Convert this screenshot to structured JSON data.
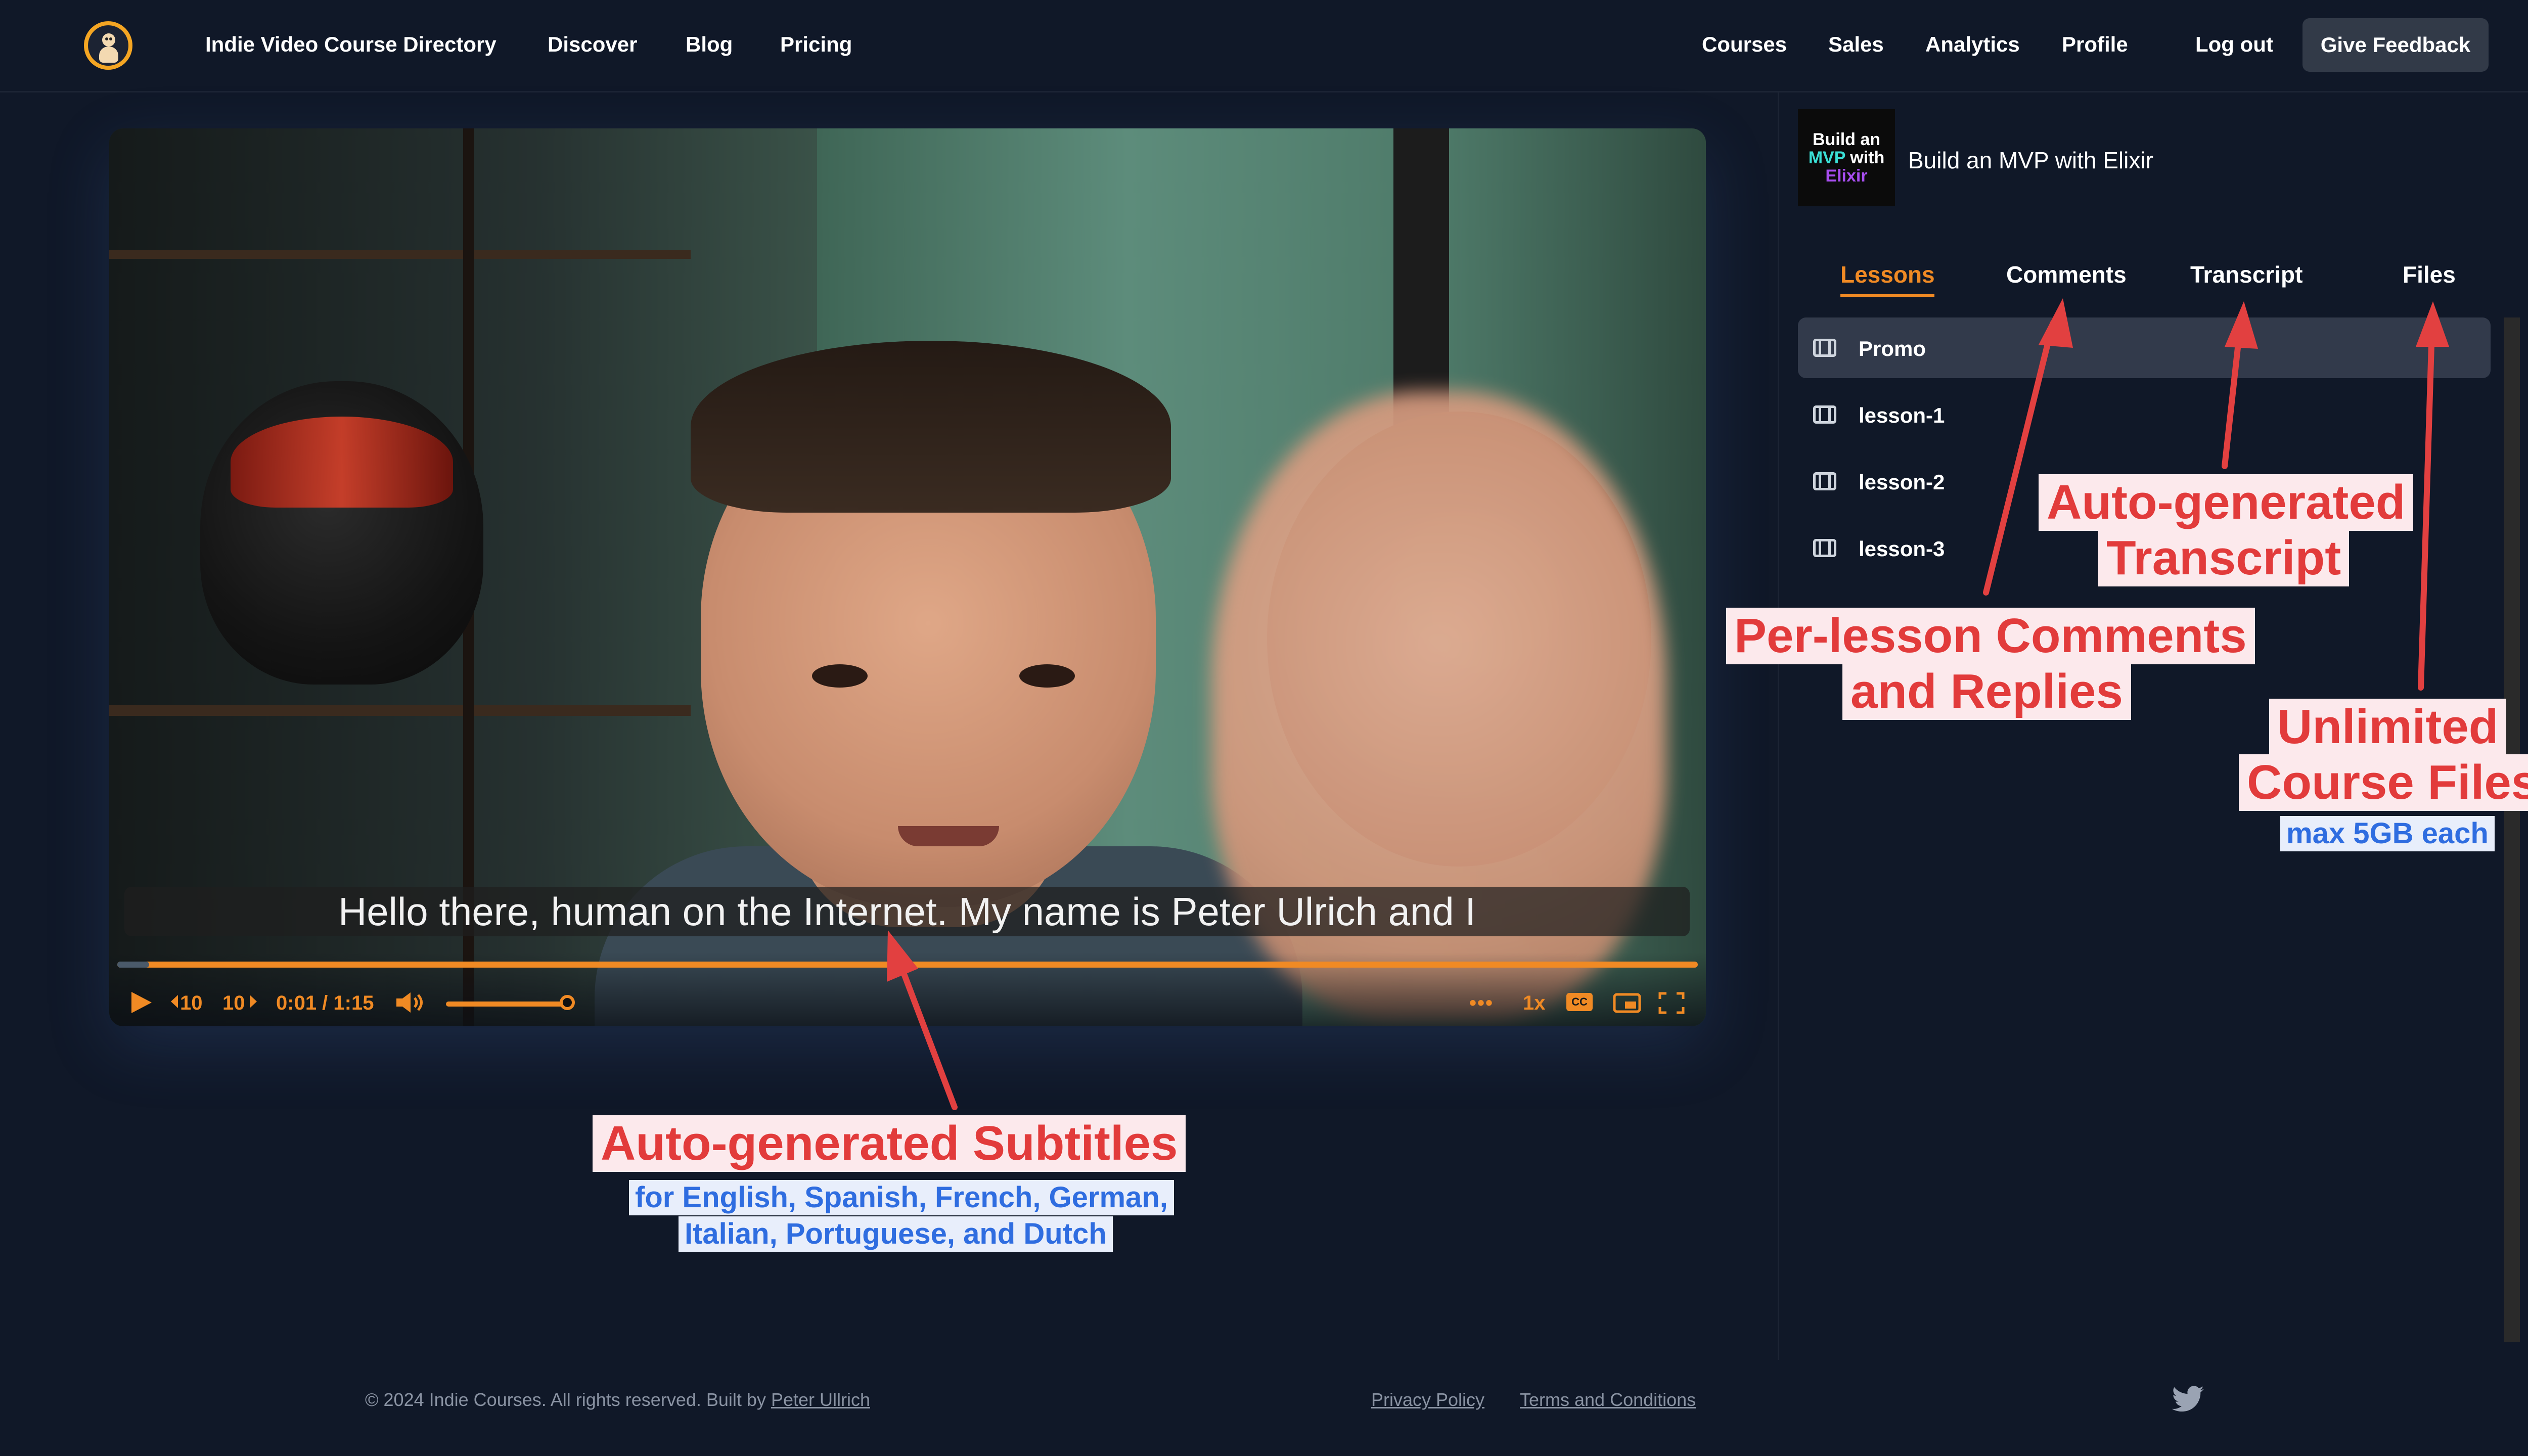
{
  "nav": {
    "brand": "Indie Video Course Directory",
    "links": [
      "Discover",
      "Blog",
      "Pricing"
    ],
    "right_links": [
      "Courses",
      "Sales",
      "Analytics",
      "Profile"
    ],
    "logout": "Log out",
    "feedback": "Give Feedback"
  },
  "video": {
    "subtitle": "Hello there, human on the Internet. My name is Peter Ulrich and I",
    "rewind": "10",
    "forward": "10",
    "time": "0:01 / 1:15",
    "speed": "1x",
    "cc": "CC",
    "more": "•••",
    "progress_fraction": 0.02,
    "volume_fraction": 0.8
  },
  "course": {
    "thumbnail_lines": [
      "Build an",
      "MVP with",
      "Elixir"
    ],
    "title": "Build an MVP with Elixir"
  },
  "tabs": [
    "Lessons",
    "Comments",
    "Transcript",
    "Files"
  ],
  "active_tab": "Lessons",
  "lessons": [
    "Promo",
    "lesson-1",
    "lesson-2",
    "lesson-3"
  ],
  "annotations": {
    "transcript": [
      "Auto-generated",
      "Transcript"
    ],
    "comments": [
      "Per-lesson Comments",
      "and Replies"
    ],
    "files": [
      "Unlimited",
      "Course Files"
    ],
    "files_sub": "max 5GB each",
    "subtitles": "Auto-generated Subtitles",
    "subtitles_sub": [
      "for English, Spanish, French, German,",
      "Italian, Portuguese, and Dutch"
    ]
  },
  "footer": {
    "copyright": "© 2024 Indie Courses. All rights reserved. Built by",
    "author": "Peter Ullrich",
    "privacy": "Privacy Policy",
    "terms": "Terms and Conditions"
  },
  "colors": {
    "background": "#101828",
    "accent": "#f08a24",
    "annotation_red": "#e23b3b",
    "annotation_blue": "#2f6de0"
  },
  "icons": [
    "logo-icon",
    "play-icon",
    "rewind-icon",
    "forward-icon",
    "volume-icon",
    "more-icon",
    "cc-icon",
    "pip-icon",
    "fullscreen-icon",
    "film-icon",
    "twitter-icon"
  ]
}
